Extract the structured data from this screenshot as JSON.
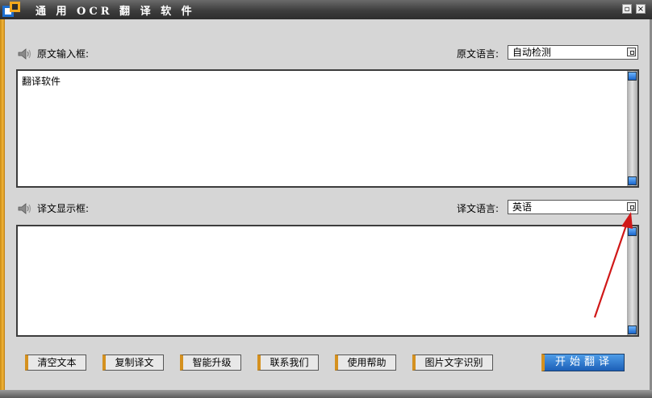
{
  "window": {
    "title": "通 用 OCR 翻 译 软 件",
    "min_symbol": "▫",
    "close_symbol": "×"
  },
  "source": {
    "label": "原文输入框:",
    "lang_label": "原文语言:",
    "lang_value": "自动检测",
    "text": "翻译软件"
  },
  "target": {
    "label": "译文显示框:",
    "lang_label": "译文语言:",
    "lang_value": "英语",
    "text": ""
  },
  "buttons": {
    "clear": "清空文本",
    "copy": "复制译文",
    "upgrade": "智能升级",
    "contact": "联系我们",
    "help": "使用帮助",
    "ocr": "图片文字识别",
    "start": "开始翻译"
  },
  "colors": {
    "accent_orange": "#d5911f",
    "start_blue": "#1c5fb7",
    "annotation_red": "#d01818"
  },
  "icons": [
    "app-logo-icon",
    "speaker-icon",
    "dropdown-icon",
    "annotation-arrow"
  ]
}
